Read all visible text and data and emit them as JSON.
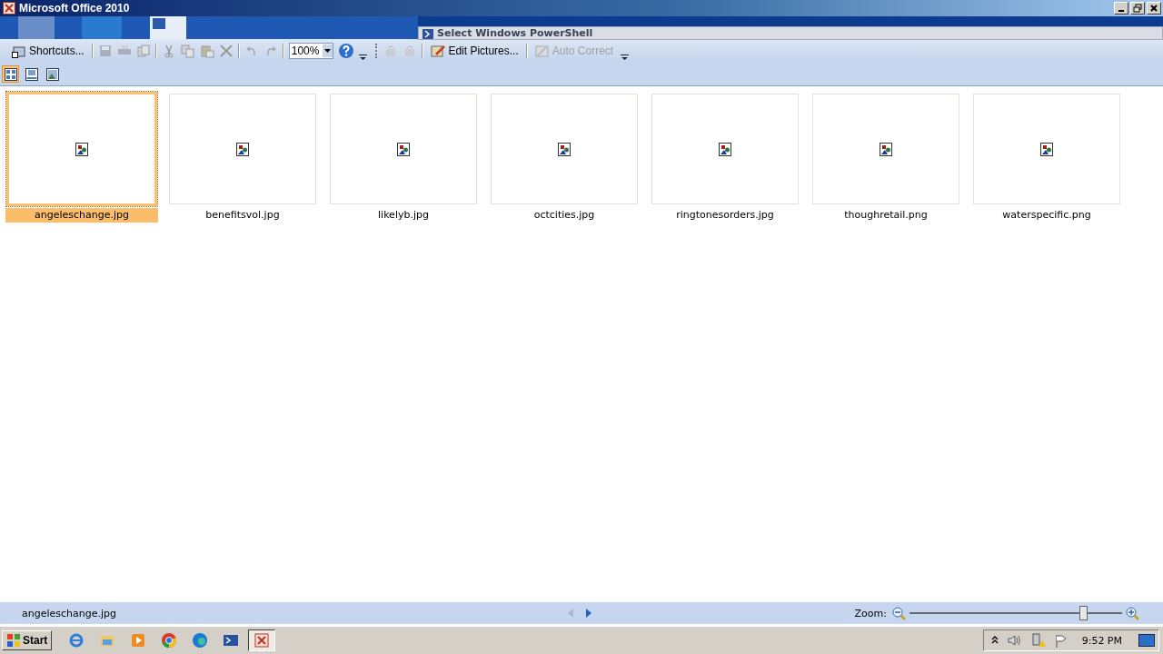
{
  "window": {
    "title": "Microsoft Office 2010"
  },
  "background_window": {
    "title": "Select Windows PowerShell"
  },
  "toolbar": {
    "shortcuts": "Shortcuts...",
    "zoom_value": "100%",
    "edit_pictures": "Edit Pictures...",
    "auto_correct": "Auto Correct",
    "auto_correct_disabled": true
  },
  "view_buttons": [
    {
      "kind": "thumbnails",
      "selected": true
    },
    {
      "kind": "filmstrip",
      "selected": false
    },
    {
      "kind": "single",
      "selected": false
    }
  ],
  "pictures": [
    {
      "name": "angeleschange.jpg",
      "selected": true
    },
    {
      "name": "benefitsvol.jpg",
      "selected": false
    },
    {
      "name": "likelyb.jpg",
      "selected": false
    },
    {
      "name": "octcities.jpg",
      "selected": false
    },
    {
      "name": "ringtonesorders.jpg",
      "selected": false
    },
    {
      "name": "thoughretail.png",
      "selected": false
    },
    {
      "name": "waterspecific.png",
      "selected": false
    }
  ],
  "status_bar": {
    "file": "angeleschange.jpg",
    "zoom_label": "Zoom:",
    "zoom_slider": {
      "level": 0.82
    }
  },
  "taskbar": {
    "start": "Start",
    "time": "9:52 PM",
    "apps": [
      {
        "kind": "ie",
        "selected": false
      },
      {
        "kind": "folder",
        "selected": false
      },
      {
        "kind": "media",
        "selected": false
      },
      {
        "kind": "chrome",
        "selected": false
      },
      {
        "kind": "edge",
        "selected": false
      },
      {
        "kind": "powershell",
        "selected": false
      },
      {
        "kind": "picturemanager",
        "selected": true
      }
    ]
  }
}
